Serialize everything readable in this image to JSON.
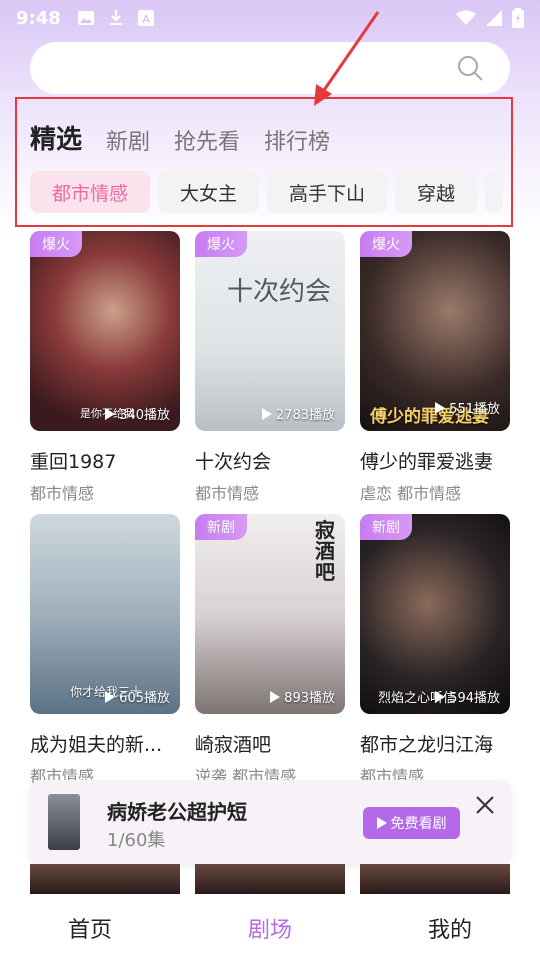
{
  "status_bar": {
    "time": "9:48",
    "left_icons": [
      "image-icon",
      "download-icon",
      "font-icon"
    ],
    "right_icons": [
      "wifi-icon",
      "signal-icon",
      "battery-icon"
    ]
  },
  "search": {
    "placeholder": ""
  },
  "tabs": [
    {
      "label": "精选",
      "active": true
    },
    {
      "label": "新剧",
      "active": false
    },
    {
      "label": "抢先看",
      "active": false
    },
    {
      "label": "排行榜",
      "active": false
    }
  ],
  "chips": [
    {
      "label": "都市情感",
      "active": true
    },
    {
      "label": "大女主",
      "active": false
    },
    {
      "label": "高手下山",
      "active": false
    },
    {
      "label": "穿越",
      "active": false
    }
  ],
  "dramas": [
    {
      "badge": "爆火",
      "plays": "340播放",
      "title": "重回1987",
      "tags": "都市情感",
      "overlay": "是你不给我"
    },
    {
      "badge": "爆火",
      "plays": "2783播放",
      "title": "十次约会",
      "tags": "都市情感",
      "overlay": "十次约会"
    },
    {
      "badge": "爆火",
      "plays": "551播放",
      "title": "傅少的罪爱逃妻",
      "tags": "虐恋 都市情感",
      "overlay": "傅少的罪爱逃妻"
    },
    {
      "badge": "",
      "plays": "605播放",
      "title": "成为姐夫的新...",
      "tags": "都市情感",
      "overlay": "你才给我三十"
    },
    {
      "badge": "新剧",
      "plays": "893播放",
      "title": "崎寂酒吧",
      "tags": "逆袭 都市情感",
      "overlay": "寂酒吧"
    },
    {
      "badge": "新剧",
      "plays": "594播放",
      "title": "都市之龙归江海",
      "tags": "都市情感",
      "overlay": "烈焰之心听信"
    }
  ],
  "mini_player": {
    "title": "病娇老公超护短",
    "episodes": "1/60集",
    "button_label": "免费看剧"
  },
  "bottom_nav": [
    {
      "label": "首页",
      "active": false
    },
    {
      "label": "剧场",
      "active": true
    },
    {
      "label": "我的",
      "active": false
    }
  ],
  "colors": {
    "accent": "#b46ae8",
    "chip_active_bg": "#fbe3ee",
    "chip_active_text": "#ee6aa0",
    "annotation_red": "#e53a3a"
  }
}
